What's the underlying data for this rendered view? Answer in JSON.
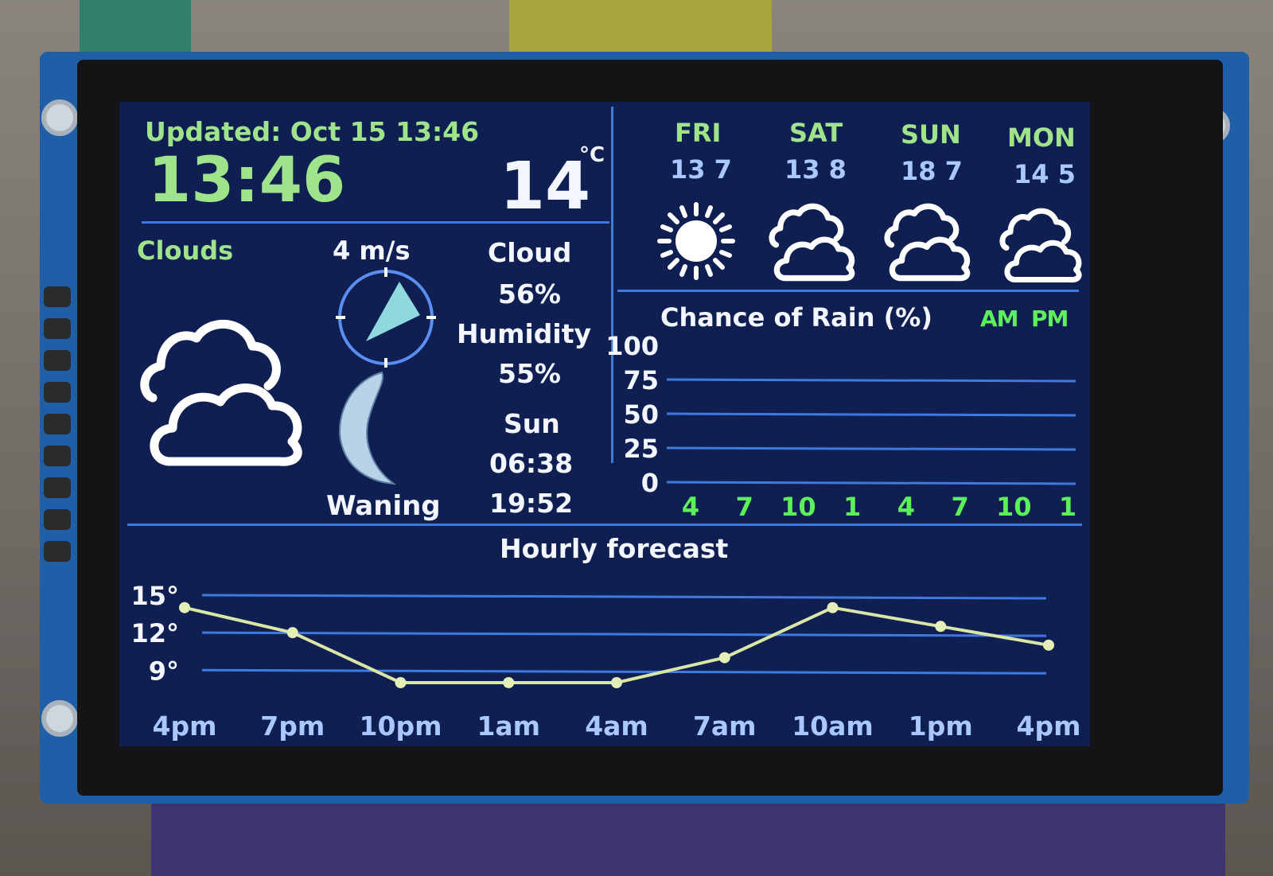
{
  "device": {
    "updated": "Updated: Oct 15 13:46",
    "time": "13:46",
    "temperature": "14",
    "temp_unit": "°C",
    "condition": "Clouds",
    "condition_icon": "cloud-icon",
    "wind": "4 m/s",
    "moon_phase": "Waning",
    "cloud_label": "Cloud",
    "cloud_value": "56%",
    "humidity_label": "Humidity",
    "humidity_value": "55%",
    "sun_label": "Sun",
    "sunrise": "06:38",
    "sunset": "19:52"
  },
  "forecast": [
    {
      "day": "FRI",
      "temps": "13 7",
      "icon": "sun-icon"
    },
    {
      "day": "SAT",
      "temps": "13 8",
      "icon": "cloud-icon"
    },
    {
      "day": "SUN",
      "temps": "18 7",
      "icon": "cloud-icon"
    },
    {
      "day": "MON",
      "temps": "14 5",
      "icon": "cloud-icon"
    }
  ],
  "rain_chart": {
    "title": "Chance of Rain (%)",
    "am_label": "AM",
    "pm_label": "PM",
    "y_ticks": [
      "100",
      "75",
      "50",
      "25",
      "0"
    ],
    "x_ticks": [
      "4",
      "7",
      "10",
      "1",
      "4",
      "7",
      "10",
      "1"
    ]
  },
  "hourly": {
    "title": "Hourly forecast",
    "y_ticks": [
      "15°",
      "12°",
      "9°"
    ],
    "x_ticks": [
      "4pm",
      "7pm",
      "10pm",
      "1am",
      "4am",
      "7am",
      "10am",
      "1pm",
      "4pm"
    ]
  },
  "chart_data": [
    {
      "type": "bar",
      "title": "Chance of Rain (%)",
      "categories": [
        "4",
        "7",
        "10",
        "1",
        "4",
        "7",
        "10",
        "1"
      ],
      "values": [
        0,
        0,
        0,
        0,
        0,
        0,
        0,
        0
      ],
      "ylim": [
        0,
        100
      ]
    },
    {
      "type": "line",
      "title": "Hourly forecast",
      "x": [
        "4pm",
        "7pm",
        "10pm",
        "1am",
        "4am",
        "7am",
        "10am",
        "1pm",
        "4pm"
      ],
      "y": [
        14,
        12,
        8,
        8,
        8,
        10,
        14,
        12.5,
        11
      ],
      "ylim": [
        8,
        15
      ],
      "colors": {
        "line": "#d9e6a6",
        "grid": "#3f79e0"
      }
    }
  ],
  "colors": {
    "screen_bg": "#0f1f52",
    "accent_green": "#9fe38a",
    "grid_blue": "#3f79e0"
  }
}
